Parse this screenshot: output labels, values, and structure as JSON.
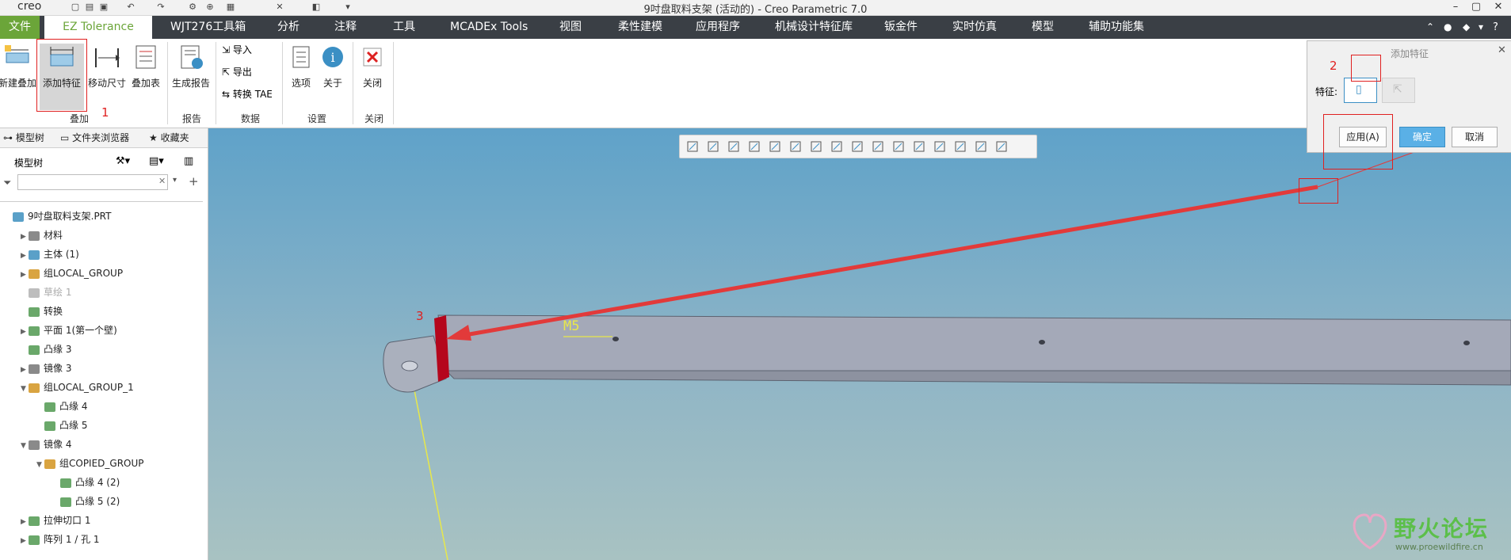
{
  "window": {
    "title": "9吋盘取料支架 (活动的) - Creo Parametric 7.0",
    "logo": "creo"
  },
  "tabs": [
    "文件",
    "EZ Tolerance",
    "WJT276工具箱",
    "分析",
    "注释",
    "工具",
    "MCADEx Tools",
    "视图",
    "柔性建模",
    "应用程序",
    "机械设计特征库",
    "钣金件",
    "实时仿真",
    "模型",
    "辅助功能集"
  ],
  "ribbon": {
    "buttons": {
      "new_stack": "新建叠加",
      "add_feature": "添加特征",
      "move_dim": "移动尺寸",
      "stack_table": "叠加表",
      "gen_report": "生成报告",
      "import": "导入",
      "export": "导出",
      "convert_tae": "转换 TAE",
      "options": "选项",
      "about": "关于",
      "close": "关闭"
    },
    "groups": {
      "stack": "叠加",
      "report": "报告",
      "data": "数据",
      "settings": "设置",
      "close": "关闭"
    }
  },
  "annotations": {
    "n1": "1",
    "n2": "2",
    "n3": "3"
  },
  "left_panel": {
    "tabs": [
      "模型树",
      "文件夹浏览器",
      "收藏夹"
    ],
    "tree_label": "模型树",
    "search_placeholder": "",
    "tree": [
      {
        "label": "9吋盘取料支架.PRT",
        "indent": 0,
        "arrow": "",
        "color": "#5aa0c8"
      },
      {
        "label": "材料",
        "indent": 1,
        "arrow": "▶",
        "color": "#8a8a8a"
      },
      {
        "label": "主体 (1)",
        "indent": 1,
        "arrow": "▶",
        "color": "#5aa0c8"
      },
      {
        "label": "组LOCAL_GROUP",
        "indent": 1,
        "arrow": "▶",
        "color": "#d9a441"
      },
      {
        "label": "草绘 1",
        "indent": 1,
        "arrow": "",
        "color": "#bdbdbd",
        "dim": true
      },
      {
        "label": "转换",
        "indent": 1,
        "arrow": "",
        "color": "#6aa86a"
      },
      {
        "label": "平面 1(第一个壁)",
        "indent": 1,
        "arrow": "▶",
        "color": "#6aa86a"
      },
      {
        "label": "凸缘 3",
        "indent": 1,
        "arrow": "",
        "color": "#6aa86a"
      },
      {
        "label": "镜像 3",
        "indent": 1,
        "arrow": "▶",
        "color": "#8a8a8a"
      },
      {
        "label": "组LOCAL_GROUP_1",
        "indent": 1,
        "arrow": "▼",
        "color": "#d9a441"
      },
      {
        "label": "凸缘 4",
        "indent": 2,
        "arrow": "",
        "color": "#6aa86a"
      },
      {
        "label": "凸缘 5",
        "indent": 2,
        "arrow": "",
        "color": "#6aa86a"
      },
      {
        "label": "镜像 4",
        "indent": 1,
        "arrow": "▼",
        "color": "#8a8a8a"
      },
      {
        "label": "组COPIED_GROUP",
        "indent": 2,
        "arrow": "▼",
        "color": "#d9a441"
      },
      {
        "label": "凸缘 4 (2)",
        "indent": 3,
        "arrow": "",
        "color": "#6aa86a"
      },
      {
        "label": "凸缘 5 (2)",
        "indent": 3,
        "arrow": "",
        "color": "#6aa86a"
      },
      {
        "label": "拉伸切口 1",
        "indent": 1,
        "arrow": "▶",
        "color": "#6aa86a"
      },
      {
        "label": "阵列 1 / 孔 1",
        "indent": 1,
        "arrow": "▶",
        "color": "#6aa86a"
      }
    ]
  },
  "viewport": {
    "label_m5": "M5"
  },
  "dialog": {
    "title": "添加特征",
    "feature_label": "特征:",
    "apply": "应用(A)",
    "ok": "确定",
    "cancel": "取消"
  },
  "watermark": {
    "name": "野火论坛",
    "url": "www.proewildfire.cn"
  }
}
